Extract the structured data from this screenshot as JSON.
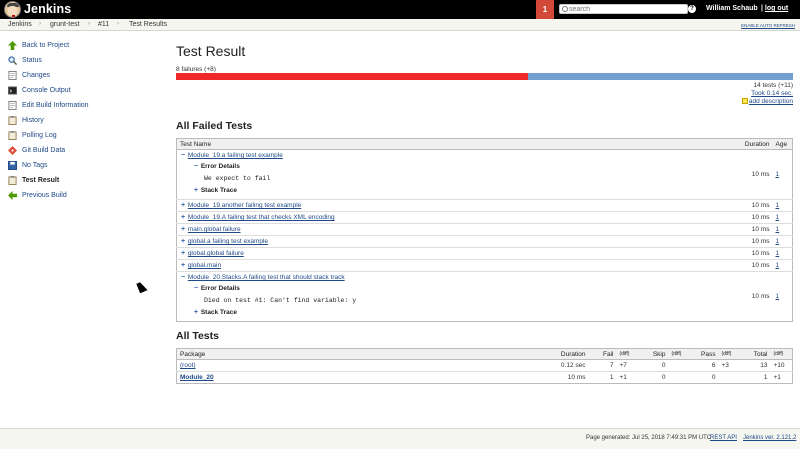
{
  "header": {
    "brand": "Jenkins",
    "notification_count": "1",
    "search_placeholder": "search",
    "help": "?",
    "user": "William Schaub",
    "logout": "log out",
    "logout_sep": "|"
  },
  "breadcrumb": {
    "items": [
      "Jenkins",
      "grunt-test",
      "#11",
      "Test Results"
    ],
    "separator": "›",
    "auto_refresh": "ENABLE AUTO REFRESH"
  },
  "sidebar": {
    "items": [
      {
        "label": "Back to Project",
        "icon": "up-arrow-icon"
      },
      {
        "label": "Status",
        "icon": "search-icon"
      },
      {
        "label": "Changes",
        "icon": "notepad-icon"
      },
      {
        "label": "Console Output",
        "icon": "terminal-icon"
      },
      {
        "label": "Edit Build Information",
        "icon": "notepad-icon"
      },
      {
        "label": "History",
        "icon": "clipboard-icon"
      },
      {
        "label": "Polling Log",
        "icon": "clipboard-icon"
      },
      {
        "label": "Git Build Data",
        "icon": "git-icon"
      },
      {
        "label": "No Tags",
        "icon": "save-icon"
      },
      {
        "label": "Test Result",
        "icon": "clipboard-icon"
      },
      {
        "label": "Previous Build",
        "icon": "back-arrow-icon"
      }
    ]
  },
  "main": {
    "title": "Test Result",
    "failures": "8 failures (+8)",
    "fail_fraction": 0.571,
    "tests": "14 tests (+11)",
    "took": "Took 0.14 sec.",
    "add_description": "add description",
    "failed_title": "All Failed Tests",
    "failed_headers": {
      "name": "Test Name",
      "duration": "Duration",
      "age": "Age"
    },
    "error_details": "Error Details",
    "stack_trace": "Stack Trace",
    "failed_rows": [
      {
        "name": "Module_19.a failing test example",
        "duration": "10 ms",
        "age": "1",
        "expanded": true,
        "error": "We expect to fail"
      },
      {
        "name": "Module_19.another failing test example",
        "duration": "10 ms",
        "age": "1"
      },
      {
        "name": "Module_19.A failing test that checks XML encoding",
        "duration": "10 ms",
        "age": "1"
      },
      {
        "name": "main.global failure",
        "duration": "10 ms",
        "age": "1"
      },
      {
        "name": "global.a failing test example",
        "duration": "10 ms",
        "age": "1"
      },
      {
        "name": "global.global failure",
        "duration": "10 ms",
        "age": "1"
      },
      {
        "name": "global.main",
        "duration": "10 ms",
        "age": "1"
      },
      {
        "name": "Module_20.Stacks.A failing test that should stack track",
        "duration": "10 ms",
        "age": "1",
        "expanded": true,
        "error": "Died on test #1: Can't find variable: y"
      }
    ],
    "all_title": "All Tests",
    "all_headers": {
      "package": "Package",
      "duration": "Duration",
      "fail": "Fail",
      "diff": "(diff)",
      "skip": "Skip",
      "pass": "Pass",
      "total": "Total"
    },
    "all_rows": [
      {
        "package": "(root)",
        "duration": "0.12 sec",
        "fail": "7",
        "fail_diff": "+7",
        "skip": "0",
        "skip_diff": "",
        "pass": "6",
        "pass_diff": "+3",
        "total": "13",
        "total_diff": "+10"
      },
      {
        "package": "Module_20",
        "duration": "10 ms",
        "fail": "1",
        "fail_diff": "+1",
        "skip": "0",
        "skip_diff": "",
        "pass": "0",
        "pass_diff": "",
        "total": "1",
        "total_diff": "+1"
      }
    ]
  },
  "footer": {
    "generated": "Page generated: Jul 25, 2018 7:49:31 PM UTC",
    "rest_api": "REST API",
    "version": "Jenkins ver. 2.121.2"
  },
  "colors": {
    "fail": "#ef2929",
    "pass": "#729fcf",
    "header": "#000000",
    "notification": "#d24939"
  }
}
